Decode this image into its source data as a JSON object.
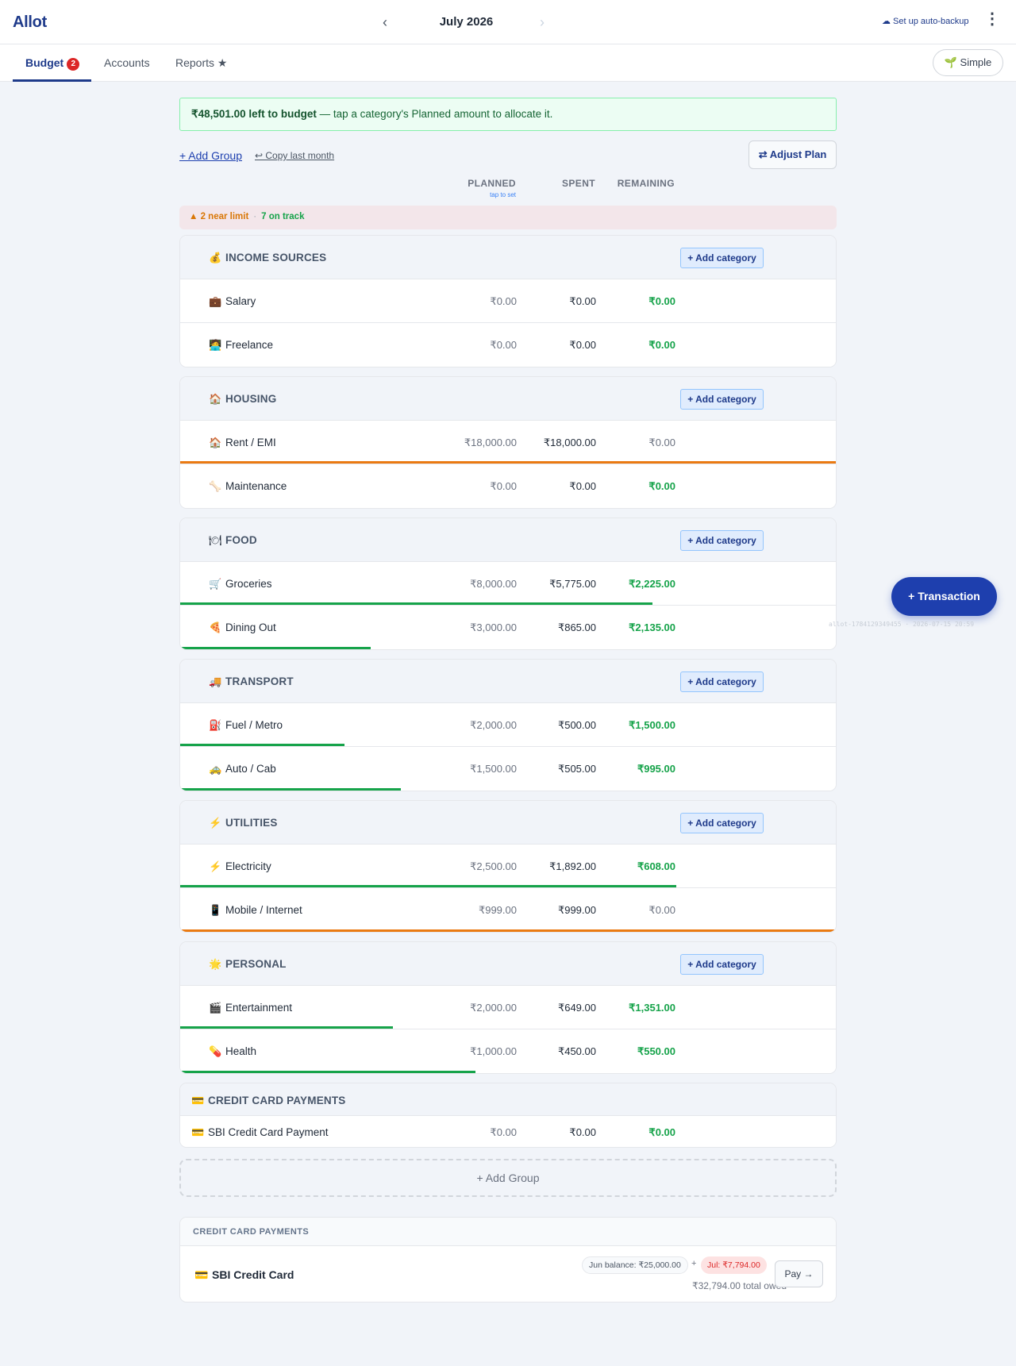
{
  "app": {
    "logo": "Allot"
  },
  "month": {
    "prev": "‹",
    "label": "July 2026",
    "next": "›"
  },
  "header": {
    "backup_label": "☁ Set up auto-backup",
    "menu": "⋮"
  },
  "tabs": {
    "budget": "Budget",
    "budget_badge": "2",
    "accounts": "Accounts",
    "reports": "Reports ★",
    "mode_button": "🌱 Simple"
  },
  "banner": {
    "amount_text": "₹48,501.00 left to budget",
    "rest_text": " — tap a category's Planned amount to allocate it."
  },
  "actions": {
    "add_group": "+ Add Group",
    "copy_last": "↩ Copy last month",
    "adjust_plan": "⇄ Adjust Plan"
  },
  "columns": {
    "planned": "PLANNED",
    "planned_hint": "tap to set",
    "spent": "SPENT",
    "remaining": "REMAINING"
  },
  "status": {
    "near_limit": "▲ 2 near limit",
    "separator": "·",
    "on_track": "7 on track"
  },
  "add_category_label": "+ Add category",
  "groups": [
    {
      "emoji": "💰",
      "name": "INCOME SOURCES",
      "rows": [
        {
          "emoji": "💼",
          "name": "Salary",
          "planned": "₹0.00",
          "spent": "₹0.00",
          "remaining": "₹0.00",
          "remaining_state": "ok",
          "progress": 0
        },
        {
          "emoji": "🧑‍💻",
          "name": "Freelance",
          "planned": "₹0.00",
          "spent": "₹0.00",
          "remaining": "₹0.00",
          "remaining_state": "ok",
          "progress": 0
        }
      ]
    },
    {
      "emoji": "🏠",
      "name": "HOUSING",
      "rows": [
        {
          "emoji": "🏠",
          "name": "Rent / EMI",
          "planned": "₹18,000.00",
          "spent": "₹18,000.00",
          "remaining": "₹0.00",
          "remaining_state": "zero",
          "progress": 1.0,
          "bar": "warn"
        },
        {
          "emoji": "🦴",
          "name": "Maintenance",
          "planned": "₹0.00",
          "spent": "₹0.00",
          "remaining": "₹0.00",
          "remaining_state": "ok",
          "progress": 0
        }
      ]
    },
    {
      "emoji": "🍽",
      "name": "FOOD",
      "rows": [
        {
          "emoji": "🛒",
          "name": "Groceries",
          "planned": "₹8,000.00",
          "spent": "₹5,775.00",
          "remaining": "₹2,225.00",
          "remaining_state": "ok",
          "progress": 0.72,
          "bar": "ok"
        },
        {
          "emoji": "🍕",
          "name": "Dining Out",
          "planned": "₹3,000.00",
          "spent": "₹865.00",
          "remaining": "₹2,135.00",
          "remaining_state": "ok",
          "progress": 0.29,
          "bar": "ok"
        }
      ]
    },
    {
      "emoji": "🚚",
      "name": "TRANSPORT",
      "rows": [
        {
          "emoji": "⛽",
          "name": "Fuel / Metro",
          "planned": "₹2,000.00",
          "spent": "₹500.00",
          "remaining": "₹1,500.00",
          "remaining_state": "ok",
          "progress": 0.25,
          "bar": "ok"
        },
        {
          "emoji": "🚕",
          "name": "Auto / Cab",
          "planned": "₹1,500.00",
          "spent": "₹505.00",
          "remaining": "₹995.00",
          "remaining_state": "ok",
          "progress": 0.337,
          "bar": "ok"
        }
      ]
    },
    {
      "emoji": "⚡",
      "name": "UTILITIES",
      "rows": [
        {
          "emoji": "⚡",
          "name": "Electricity",
          "planned": "₹2,500.00",
          "spent": "₹1,892.00",
          "remaining": "₹608.00",
          "remaining_state": "ok",
          "progress": 0.757,
          "bar": "ok"
        },
        {
          "emoji": "📱",
          "name": "Mobile / Internet",
          "planned": "₹999.00",
          "spent": "₹999.00",
          "remaining": "₹0.00",
          "remaining_state": "zero",
          "progress": 1.0,
          "bar": "warn"
        }
      ]
    },
    {
      "emoji": "🌟",
      "name": "PERSONAL",
      "rows": [
        {
          "emoji": "🎬",
          "name": "Entertainment",
          "planned": "₹2,000.00",
          "spent": "₹649.00",
          "remaining": "₹1,351.00",
          "remaining_state": "ok",
          "progress": 0.325,
          "bar": "ok"
        },
        {
          "emoji": "💊",
          "name": "Health",
          "planned": "₹1,000.00",
          "spent": "₹450.00",
          "remaining": "₹550.00",
          "remaining_state": "ok",
          "progress": 0.45,
          "bar": "ok"
        }
      ]
    }
  ],
  "cc_group": {
    "emoji": "💳",
    "name": "CREDIT CARD PAYMENTS",
    "row": {
      "emoji": "💳",
      "name": "SBI Credit Card Payment",
      "planned": "₹0.00",
      "spent": "₹0.00",
      "remaining": "₹0.00"
    }
  },
  "add_group_box": "+ Add Group",
  "cc_summary": {
    "title": "CREDIT CARD PAYMENTS",
    "card_icon": "💳",
    "card_name": "SBI Credit Card",
    "balance_pill": "Jun balance: ₹25,000.00",
    "plus": "+",
    "jul_pill": "Jul: ₹7,794.00",
    "total_owed": "₹32,794.00 total owed",
    "pay_label": "Pay →"
  },
  "fab_label": "+ Transaction",
  "watermark": "allot-1784129349455 · 2026-07-15 20:59",
  "colors": {
    "brand": "#1e3a8a",
    "positive": "#16a34a",
    "warning": "#ea7a12",
    "danger": "#dc2626"
  }
}
